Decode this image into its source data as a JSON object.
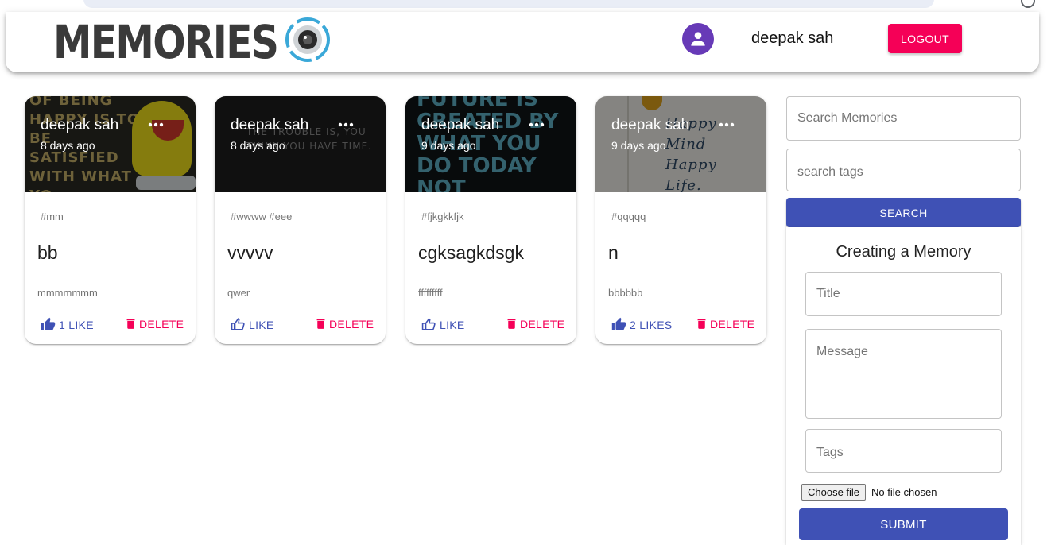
{
  "app": {
    "brand_text": "MEMORIES",
    "username": "deepak sah",
    "logout_label": "LOGOUT"
  },
  "posts": [
    {
      "author": "deepak sah",
      "time": "8 days ago",
      "tags": "#mm",
      "title": "bb",
      "message": "mmmmmmm",
      "like_label": "1 LIKE",
      "delete_label": "DELETE",
      "image_text": "OF BEING HAPPY IS TO BE SATISFIED WITH WHAT YO"
    },
    {
      "author": "deepak sah",
      "time": "8 days ago",
      "tags": "#wwww #eee",
      "title": "vvvvv",
      "message": "qwer",
      "like_label": "LIKE",
      "delete_label": "DELETE",
      "image_text": "THE TROUBLE IS, YOU THINK YOU HAVE TIME."
    },
    {
      "author": "deepak sah",
      "time": "9 days ago",
      "tags": "#fjkgkkfjk",
      "title": "cgksagkdsgk",
      "message": "fffffffff",
      "like_label": "LIKE",
      "delete_label": "DELETE",
      "image_text": "FUTURE IS CREATED BY WHAT YOU DO TODAY NOT"
    },
    {
      "author": "deepak sah",
      "time": "9 days ago",
      "tags": "#qqqqq",
      "title": "n",
      "message": "bbbbbb",
      "like_label": "2 LIKES",
      "delete_label": "DELETE",
      "image_text": "Happy Mind Happy Life."
    }
  ],
  "search": {
    "memories_placeholder": "Search Memories",
    "tags_placeholder": "search tags",
    "button_label": "SEARCH"
  },
  "form": {
    "heading": "Creating a Memory",
    "title_placeholder": "Title",
    "message_placeholder": "Message",
    "tags_placeholder": "Tags",
    "choose_file_label": "Choose file",
    "file_status": "No file chosen",
    "submit_label": "SUBMIT"
  },
  "colors": {
    "primary": "#3f51b5",
    "secondary": "#f50057",
    "avatar": "#673ab7"
  }
}
